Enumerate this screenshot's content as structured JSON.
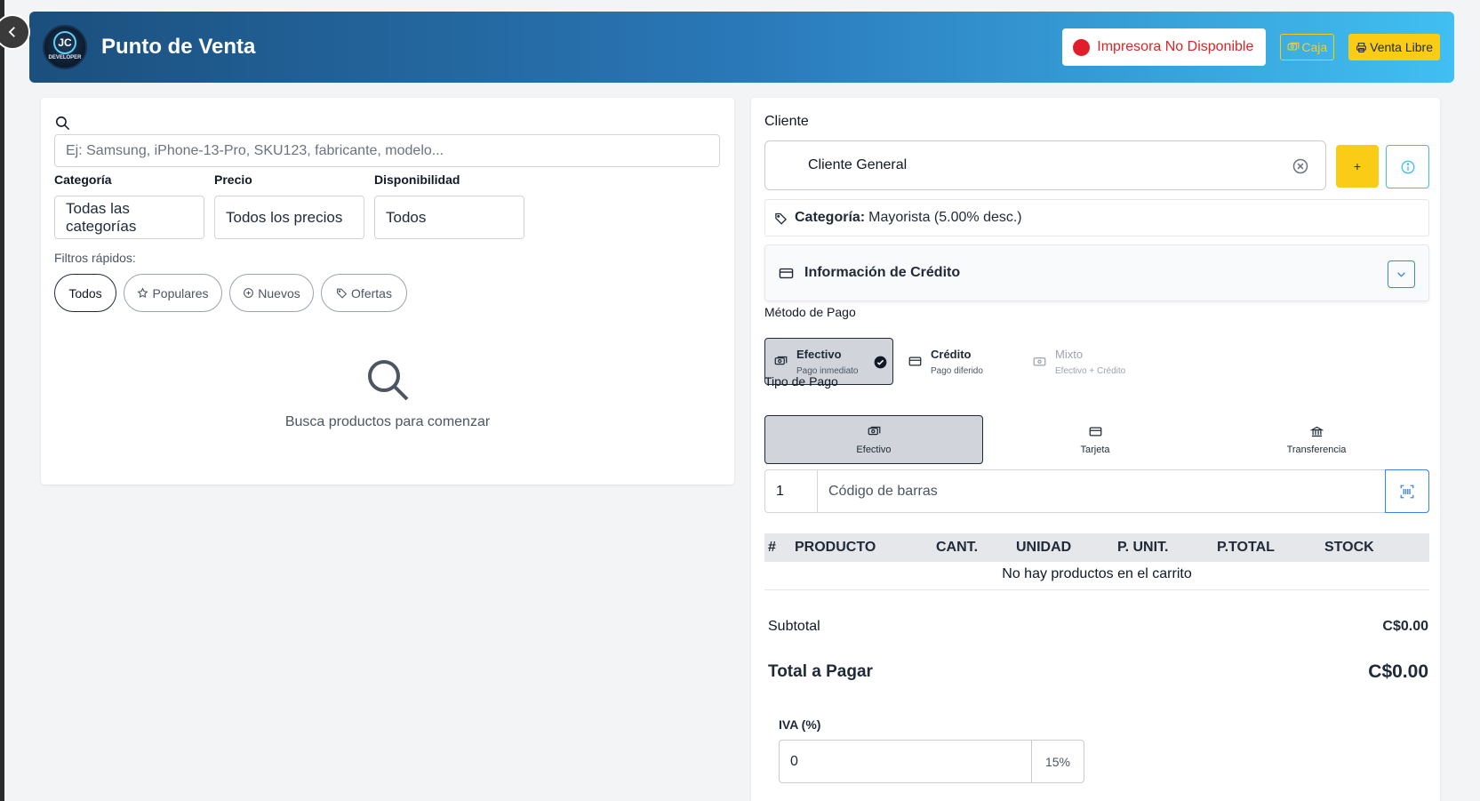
{
  "header": {
    "logo_top": "JC",
    "logo_bottom": "DEVELOPER",
    "title": "Punto de Venta",
    "printer_status": "Impresora No Disponible",
    "caja_label": "Caja",
    "venta_libre_label": "Venta Libre"
  },
  "search": {
    "placeholder": "Ej: Samsung, iPhone-13-Pro, SKU123, fabricante, modelo..."
  },
  "filters": {
    "category_label": "Categoría",
    "category_value": "Todas las categorías",
    "price_label": "Precio",
    "price_value": "Todos los precios",
    "availability_label": "Disponibilidad",
    "availability_value": "Todos",
    "quick_label": "Filtros rápidos:",
    "quick": [
      "Todos",
      "Populares",
      "Nuevos",
      "Ofertas"
    ]
  },
  "products": {
    "empty_text": "Busca productos para comenzar"
  },
  "client": {
    "label": "Cliente",
    "value": "Cliente General",
    "add_label": "+",
    "category_prefix": "Categoría:",
    "category_value": "Mayorista (5.00% desc.)",
    "credit_title": "Información de Crédito"
  },
  "payment_method": {
    "label": "Método de Pago",
    "options": [
      {
        "title": "Efectivo",
        "subtitle": "Pago inmediato"
      },
      {
        "title": "Crédito",
        "subtitle": "Pago diferido"
      },
      {
        "title": "Mixto",
        "subtitle": "Efectivo + Crédito"
      }
    ]
  },
  "payment_type": {
    "label": "Tipo de Pago",
    "options": [
      "Efectivo",
      "Tarjeta",
      "Transferencia"
    ]
  },
  "barcode": {
    "quantity": "1",
    "placeholder": "Código de barras"
  },
  "cart": {
    "columns": [
      "#",
      "PRODUCTO",
      "CANT.",
      "UNIDAD",
      "P. UNIT.",
      "P.TOTAL",
      "STOCK"
    ],
    "empty_text": "No hay productos en el carrito"
  },
  "totals": {
    "subtotal_label": "Subtotal",
    "subtotal_value": "C$0.00",
    "total_label": "Total a Pagar",
    "total_value": "C$0.00"
  },
  "iva": {
    "label": "IVA (%)",
    "value": "0",
    "suffix": "15%"
  },
  "colors": {
    "header_start": "#1b4f7d",
    "header_end": "#41bff2",
    "accent_yellow": "#facc15",
    "error_red": "#dc2626",
    "info_blue": "#3b82f6"
  }
}
